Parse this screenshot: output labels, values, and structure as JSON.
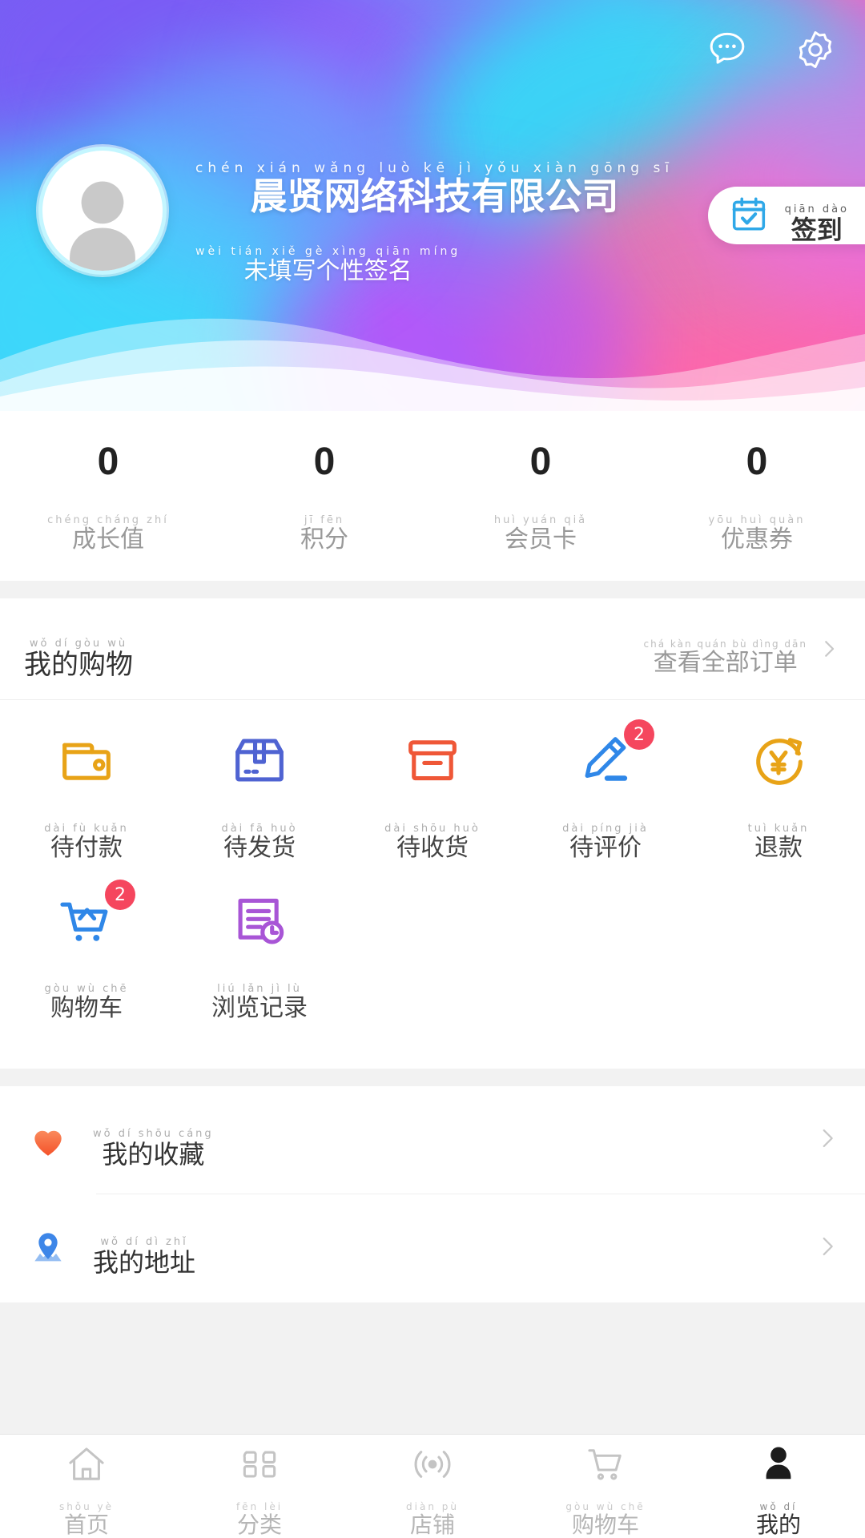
{
  "header": {
    "icons": [
      {
        "name": "chat-icon",
        "label": "chat"
      },
      {
        "name": "gear-icon",
        "label": "settings"
      }
    ],
    "avatar_alt": "default-user-avatar",
    "user_name": {
      "hanzi": "晨贤网络科技有限公司",
      "pinyin": "chén xián wǎng luò kē jì yǒu xiàn gōng sī"
    },
    "signature": {
      "hanzi": "未填写个性签名",
      "pinyin": "wèi tián xiě gè xìng qiān míng"
    },
    "signin": {
      "hanzi": "签到",
      "pinyin": "qiān dào",
      "icon": "calendar-check-icon"
    },
    "accent": "#35e0f2"
  },
  "stats": [
    {
      "value": "0",
      "hanzi": "成长值",
      "pinyin": "chéng cháng zhí"
    },
    {
      "value": "0",
      "hanzi": "积分",
      "pinyin": "jī fēn"
    },
    {
      "value": "0",
      "hanzi": "会员卡",
      "pinyin": "huì yuán qiǎ"
    },
    {
      "value": "0",
      "hanzi": "优惠券",
      "pinyin": "yōu huì quàn"
    }
  ],
  "shopping": {
    "title": {
      "hanzi": "我的购物",
      "pinyin": "wǒ dí gòu wù"
    },
    "more": {
      "hanzi": "查看全部订单",
      "pinyin": "chá kàn quán bù dìng dān"
    },
    "items": [
      {
        "hanzi": "待付款",
        "pinyin": "dài fù kuǎn",
        "icon": "wallet-icon",
        "color": "#e8a317",
        "badge": ""
      },
      {
        "hanzi": "待发货",
        "pinyin": "dài fā huò",
        "icon": "package-box-icon",
        "color": "#4f63d2",
        "badge": ""
      },
      {
        "hanzi": "待收货",
        "pinyin": "dài shōu huò",
        "icon": "delivery-box-icon",
        "color": "#ef5737",
        "badge": ""
      },
      {
        "hanzi": "待评价",
        "pinyin": "dài píng jià",
        "icon": "pencil-review-icon",
        "color": "#2f87e8",
        "badge": "2"
      },
      {
        "hanzi": "退款",
        "pinyin": "tuì kuǎn",
        "icon": "refund-yen-icon",
        "color": "#e8a317",
        "badge": ""
      },
      {
        "hanzi": "购物车",
        "pinyin": "gòu wù chē",
        "icon": "shopping-cart-icon",
        "color": "#2f87e8",
        "badge": "2"
      },
      {
        "hanzi": "浏览记录",
        "pinyin": "liú lǎn jì lù",
        "icon": "history-doc-icon",
        "color": "#a855d6",
        "badge": ""
      }
    ]
  },
  "list": [
    {
      "hanzi": "我的收藏",
      "pinyin": "wǒ dí shōu cáng",
      "icon": "heart-icon",
      "color": "#f4633a"
    },
    {
      "hanzi": "我的地址",
      "pinyin": "wǒ dí dì zhǐ",
      "icon": "map-pin-icon",
      "color": "#3d86e8"
    }
  ],
  "tabs": [
    {
      "hanzi": "首页",
      "pinyin": "shǒu yè",
      "icon": "home-icon",
      "active": false
    },
    {
      "hanzi": "分类",
      "pinyin": "fēn lèi",
      "icon": "grid-category-icon",
      "active": false
    },
    {
      "hanzi": "店铺",
      "pinyin": "diàn pù",
      "icon": "shop-signal-icon",
      "active": false
    },
    {
      "hanzi": "购物车",
      "pinyin": "gòu wù chē",
      "icon": "cart-outline-icon",
      "active": false
    },
    {
      "hanzi": "我的",
      "pinyin": "wǒ dí",
      "icon": "person-icon",
      "active": true
    }
  ],
  "badge_color": "#f5465e"
}
